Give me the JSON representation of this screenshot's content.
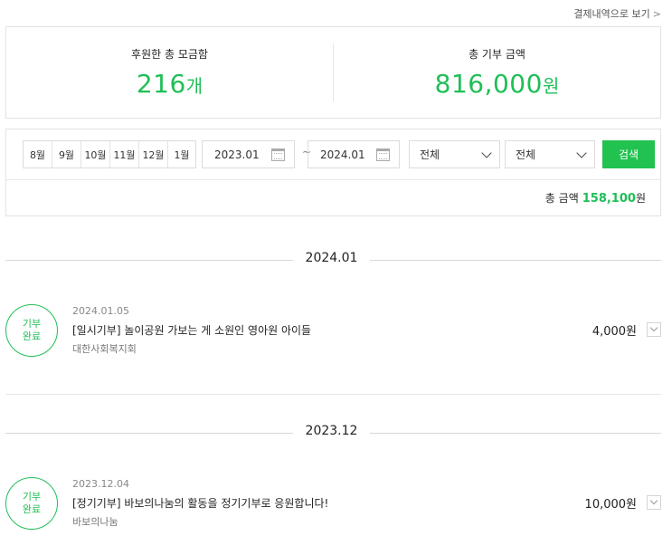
{
  "header": {
    "history_link": "결제내역으로 보기",
    "chevron": ">"
  },
  "summary": {
    "count_label": "후원한 총 모금함",
    "count_value": "216",
    "count_unit": "개",
    "amount_label": "총 기부 금액",
    "amount_value": "816,000",
    "amount_unit": "원"
  },
  "filter": {
    "months": [
      "8월",
      "9월",
      "10월",
      "11월",
      "12월",
      "1월"
    ],
    "start_date": "2023.01",
    "tilde": "~",
    "end_date": "2024.01",
    "select1": "전체",
    "select2": "전체",
    "search_label": "검색",
    "total_label": "총 금액",
    "total_amount": "158,100",
    "total_unit": "원"
  },
  "groups": [
    {
      "month": "2024.01",
      "items": [
        {
          "badge_line1": "기부",
          "badge_line2": "완료",
          "date": "2024.01.05",
          "title": "[일시기부] 놀이공원 가보는 게 소원인 영아원 아이들",
          "org": "대한사회복지회",
          "amount": "4,000원"
        }
      ]
    },
    {
      "month": "2023.12",
      "items": [
        {
          "badge_line1": "기부",
          "badge_line2": "완료",
          "date": "2023.12.04",
          "title": "[정기기부] 바보의나눔의 활동을 정기기부로 응원합니다!",
          "org": "바보의나눔",
          "amount": "10,000원"
        }
      ]
    }
  ],
  "colors": {
    "accent": "#1fbf57",
    "button": "#21c24f",
    "border": "#e2e2e2"
  }
}
